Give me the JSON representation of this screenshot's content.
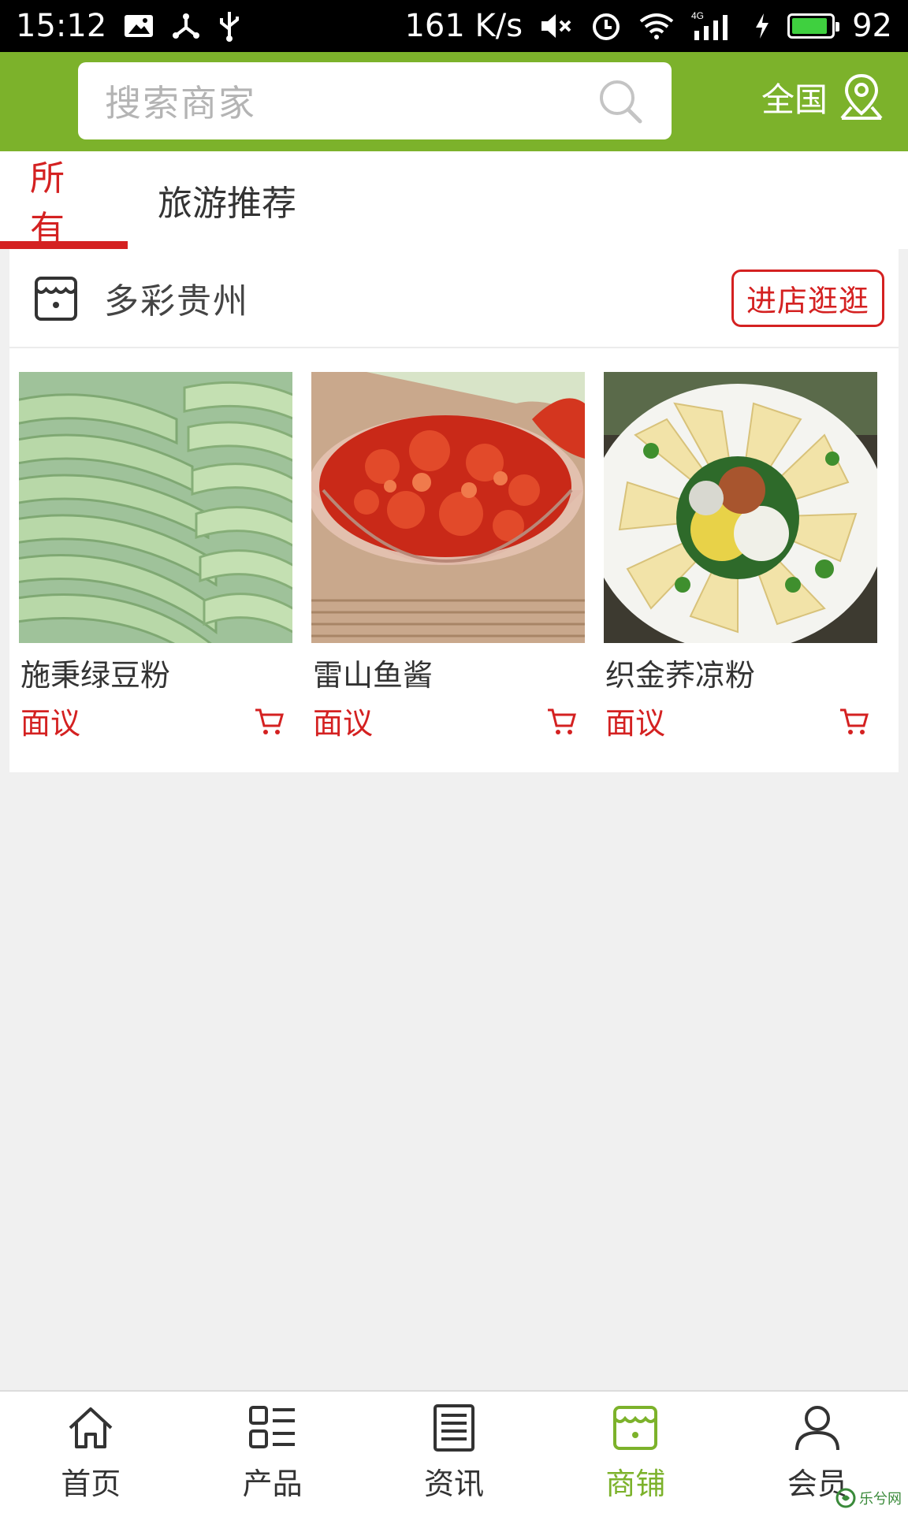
{
  "status_bar": {
    "time": "15:12",
    "net_speed": "161 K/s",
    "network": "4G",
    "battery": "92",
    "battery_level": 0.92
  },
  "header": {
    "search_placeholder": "搜索商家",
    "region": "全国",
    "accent_color": "#7cb22b"
  },
  "tabs": [
    {
      "label": "所有",
      "active": true
    },
    {
      "label": "旅游推荐",
      "active": false
    }
  ],
  "shop": {
    "name": "多彩贵州",
    "enter_label": "进店逛逛",
    "products": [
      {
        "name": "施秉绿豆粉",
        "price": "面议"
      },
      {
        "name": "雷山鱼酱",
        "price": "面议"
      },
      {
        "name": "织金荞凉粉",
        "price": "面议"
      }
    ]
  },
  "bottom_nav": [
    {
      "label": "首页",
      "icon": "home-icon",
      "active": false
    },
    {
      "label": "产品",
      "icon": "list-icon",
      "active": false
    },
    {
      "label": "资讯",
      "icon": "news-icon",
      "active": false
    },
    {
      "label": "商铺",
      "icon": "store-icon",
      "active": true
    },
    {
      "label": "会员",
      "icon": "user-icon",
      "active": false
    }
  ],
  "watermark": "乐兮网",
  "colors": {
    "accent": "#7cb22b",
    "highlight": "#d42121"
  }
}
